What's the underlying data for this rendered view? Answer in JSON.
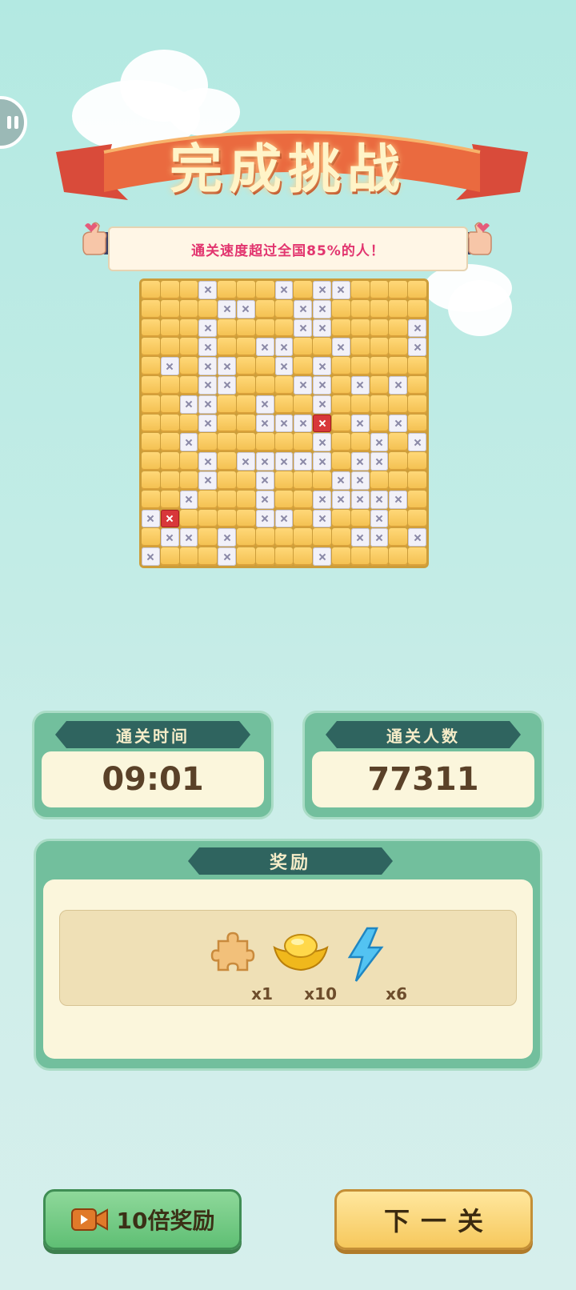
{
  "header": {
    "title": "完成挑战",
    "banner_text": "通关速度超过全国85%的人！"
  },
  "board": {
    "size": 15,
    "rows": [
      "...x...x.xx....",
      "....xx..xx.....",
      "...x....xx....x",
      "...x..xx..x...x",
      ".x.xx..x.x.....",
      "...xx...xx.x.x.",
      "..xx..x..x.....",
      "...x..xxxR.x.x.",
      "..x......x..x.x",
      "...x.xxxxx.xx..",
      "...x..x...xx...",
      "..x...x..xxxxx.",
      "xR....xx.x..x..",
      ".xx.x......xx.x",
      "x...x....x....."
    ]
  },
  "stats": {
    "time_label": "通关时间",
    "time_value": "09:01",
    "players_label": "通关人数",
    "players_value": "77311"
  },
  "rewards": {
    "label": "奖励",
    "items": [
      {
        "icon": "puzzle-piece-icon",
        "count": "x1"
      },
      {
        "icon": "gold-ingot-icon",
        "count": "x10"
      },
      {
        "icon": "lightning-icon",
        "count": "x6"
      }
    ]
  },
  "buttons": {
    "video_reward": "10倍奖励",
    "next_level": "下一关"
  }
}
